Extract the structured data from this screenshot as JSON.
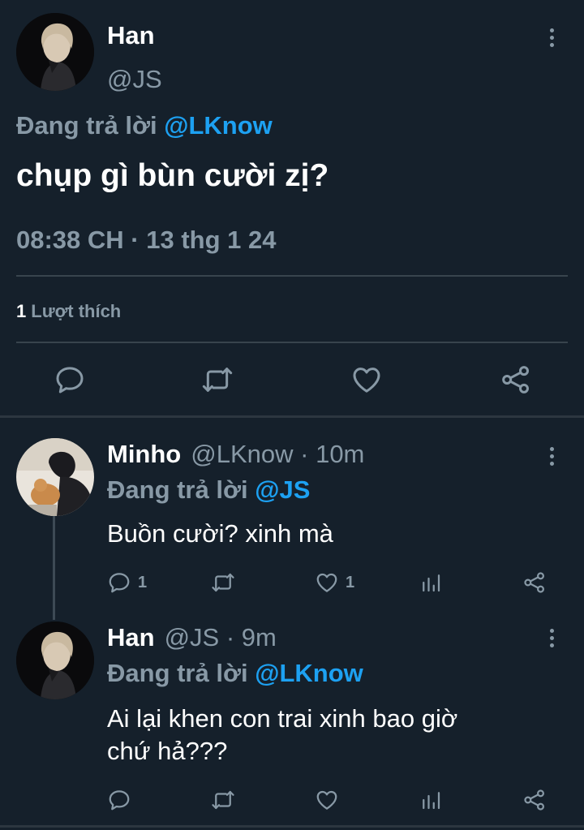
{
  "colors": {
    "background": "#15202b",
    "secondary_text": "#8899a6",
    "mention": "#1da1f2",
    "divider": "#38444d"
  },
  "main_tweet": {
    "author_name": "Han",
    "author_handle": "@JS",
    "replying_prefix": "Đang trả lời",
    "replying_to": "@LKnow",
    "text": "chụp gì bùn cười zị?",
    "timestamp": "08:38 CH · 13 thg 1 24",
    "like_count": "1",
    "like_label": "Lượt thích",
    "actions": [
      "reply-icon",
      "retweet-icon",
      "like-icon",
      "share-icon"
    ]
  },
  "replies": [
    {
      "author_name": "Minho",
      "author_handle": "@LKnow",
      "time": "· 10m",
      "replying_prefix": "Đang trả lời",
      "replying_to": "@JS",
      "text": "Buồn cười? xinh mà",
      "reply_count": "1",
      "retweet_count": "",
      "like_count": "1",
      "actions": [
        "reply-icon",
        "retweet-icon",
        "like-icon",
        "analytics-icon",
        "share-icon"
      ]
    },
    {
      "author_name": "Han",
      "author_handle": "@JS",
      "time": "· 9m",
      "replying_prefix": "Đang trả lời",
      "replying_to": "@LKnow",
      "text_line1": "Ai lại khen con trai xinh bao giờ",
      "text_line2": "chứ hả???",
      "reply_count": "",
      "retweet_count": "",
      "like_count": "",
      "actions": [
        "reply-icon",
        "retweet-icon",
        "like-icon",
        "analytics-icon",
        "share-icon"
      ]
    }
  ]
}
